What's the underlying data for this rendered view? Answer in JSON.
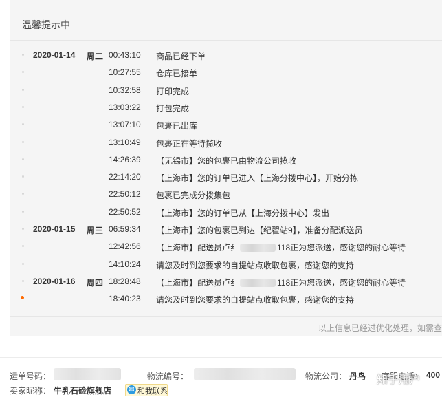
{
  "panel": {
    "title": "温馨提示中",
    "footer_note": "以上信息已经过优化处理，如需查"
  },
  "timeline": [
    {
      "date": "2020-01-14",
      "weekday": "周二",
      "time": "00:43:10",
      "pre": "商品已经下单",
      "post": ""
    },
    {
      "date": "",
      "weekday": "",
      "time": "10:27:55",
      "pre": "仓库已接单",
      "post": ""
    },
    {
      "date": "",
      "weekday": "",
      "time": "10:32:58",
      "pre": "打印完成",
      "post": ""
    },
    {
      "date": "",
      "weekday": "",
      "time": "13:03:22",
      "pre": "打包完成",
      "post": ""
    },
    {
      "date": "",
      "weekday": "",
      "time": "13:07:10",
      "pre": "包裹已出库",
      "post": ""
    },
    {
      "date": "",
      "weekday": "",
      "time": "13:10:49",
      "pre": "包裹正在等待揽收",
      "post": ""
    },
    {
      "date": "",
      "weekday": "",
      "time": "14:26:39",
      "pre": "【无锡市】您的包裹已由物流公司揽收",
      "post": ""
    },
    {
      "date": "",
      "weekday": "",
      "time": "22:14:20",
      "pre": "【上海市】您的订单已进入【上海分拨中心】，开始分拣",
      "post": ""
    },
    {
      "date": "",
      "weekday": "",
      "time": "22:50:12",
      "pre": "包裹已完成分拨集包",
      "post": ""
    },
    {
      "date": "",
      "weekday": "",
      "time": "22:50:52",
      "pre": "【上海市】您的订单已从【上海分拨中心】发出",
      "post": ""
    },
    {
      "date": "2020-01-15",
      "weekday": "周三",
      "time": "06:59:34",
      "pre": "【上海市】您的包裹已到达【纪翟站9】，准备分配派送员",
      "post": ""
    },
    {
      "date": "",
      "weekday": "",
      "time": "12:42:56",
      "pre": "【上海市】配送员卢纟",
      "post": "118正为您派送，感谢您的耐心等待"
    },
    {
      "date": "",
      "weekday": "",
      "time": "14:10:24",
      "pre": "请您及时到您要求的自提站点收取包裹，感谢您的支持",
      "post": ""
    },
    {
      "date": "2020-01-16",
      "weekday": "周四",
      "time": "18:28:48",
      "pre": "【上海市】配送员卢纟",
      "post": "118正为您派送，感谢您的耐心等待"
    },
    {
      "date": "",
      "weekday": "",
      "time": "18:40:23",
      "pre": "请您及时到您要求的自提站点收取包裹，感谢您的支持",
      "post": ""
    }
  ],
  "info": {
    "tracking_label": "运单号码：",
    "logistics_no_label": "物流编号：",
    "company_label": "物流公司：",
    "company_value": "丹鸟",
    "phone_label": "客服电话：",
    "phone_value": "400",
    "seller_label": "卖家昵称：",
    "seller_value": "牛乳石硷旗舰店",
    "contact_label": "和我联系"
  },
  "watermark": "知乎用户",
  "colors": {
    "active_dot": "#ff6a00",
    "panel_bg": "#f5f5f5"
  }
}
